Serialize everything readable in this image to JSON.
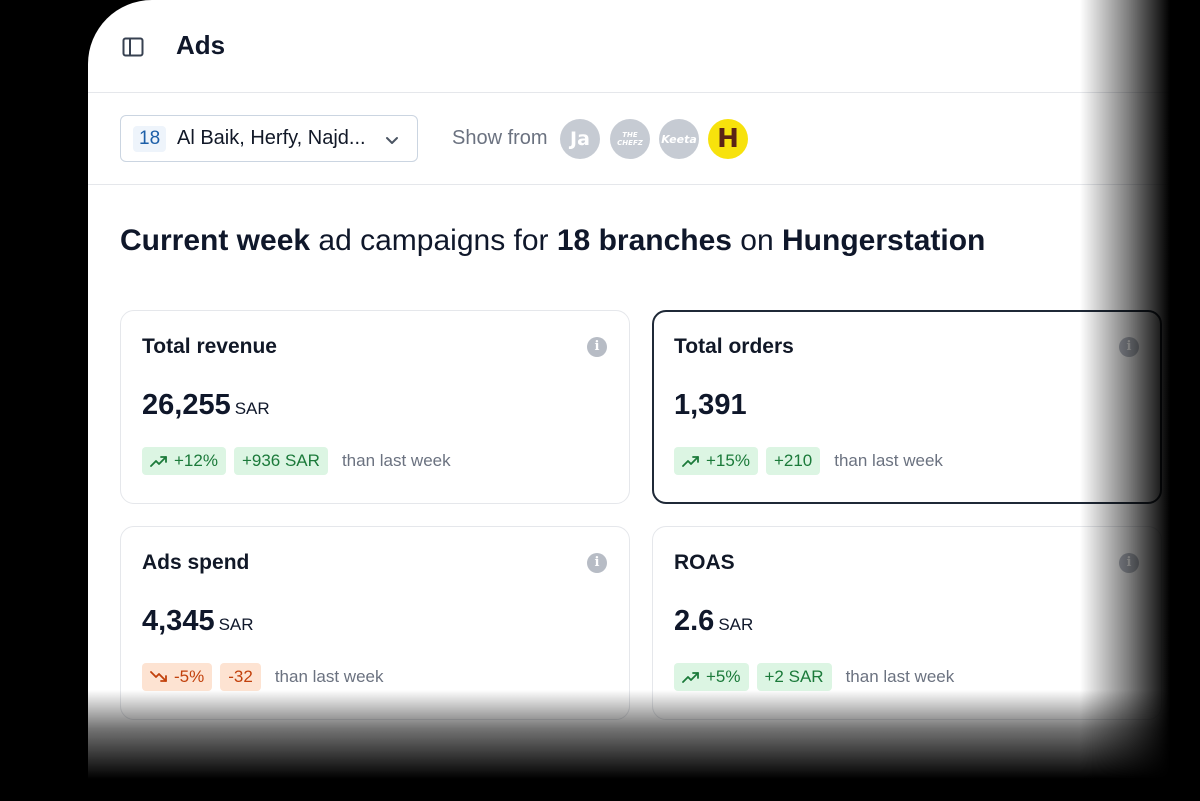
{
  "header": {
    "title": "Ads"
  },
  "filters": {
    "branch_count": "18",
    "branch_label": "Al Baik, Herfy, Najd...",
    "show_from_label": "Show from",
    "platforms": [
      {
        "name": "Jahez",
        "glyph": "Ja"
      },
      {
        "name": "The Chefz",
        "glyph_line1": "THE",
        "glyph_line2": "CHEFZ"
      },
      {
        "name": "Keeta",
        "glyph": "Keeta"
      },
      {
        "name": "Hungerstation",
        "glyph": "H",
        "color": "#f7e20c"
      }
    ]
  },
  "headline": {
    "part1_bold": "Current week",
    "part2": " ad campaigns for ",
    "part3_bold": "18 branches",
    "part4": " on ",
    "part5_bold": "Hungerstation"
  },
  "cards": [
    {
      "title": "Total revenue",
      "value": "26,255",
      "unit": "SAR",
      "pct": "+12%",
      "abs": "+936 SAR",
      "trend": "up",
      "note": "than last week"
    },
    {
      "title": "Total orders",
      "value": "1,391",
      "unit": "",
      "pct": "+15%",
      "abs": "+210",
      "trend": "up",
      "note": "than last week",
      "selected": true
    },
    {
      "title": "Ads spend",
      "value": "4,345",
      "unit": "SAR",
      "pct": "-5%",
      "abs": "-32",
      "trend": "down",
      "note": "than last week"
    },
    {
      "title": "ROAS",
      "value": "2.6",
      "unit": "SAR",
      "pct": "+5%",
      "abs": "+2 SAR",
      "trend": "up",
      "note": "than last week"
    }
  ],
  "colors": {
    "positive": "#1b7a3a",
    "positive_bg": "#dcf5e3",
    "negative": "#c2410c",
    "negative_bg": "#fde3d2",
    "selected_border": "#1f2937"
  }
}
